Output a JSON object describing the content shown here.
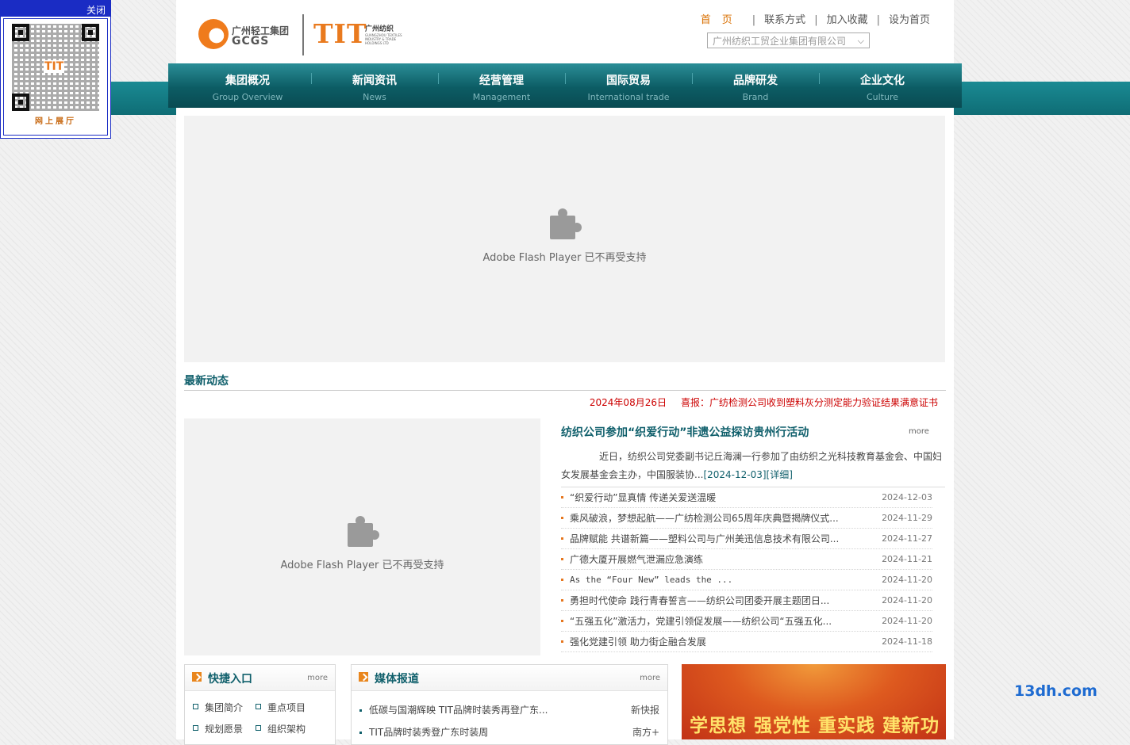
{
  "header": {
    "logo_gcgs_cn": "广州轻工集团",
    "logo_gcgs_en": "GCGS",
    "logo_tit_big": "TIT",
    "logo_tit_cn": "广州纺织",
    "logo_tit_en": "GUANGZHOU TEXTILES INDUSTRY & TRADE HOLDINGS LTD",
    "links": [
      "首页",
      "联系方式",
      "加入收藏",
      "设为首页"
    ],
    "site_select": "广州纺织工贸企业集团有限公司"
  },
  "nav": [
    {
      "cn": "集团概况",
      "en": "Group Overview"
    },
    {
      "cn": "新闻资讯",
      "en": "News"
    },
    {
      "cn": "经营管理",
      "en": "Management"
    },
    {
      "cn": "国际贸易",
      "en": "International trade"
    },
    {
      "cn": "品牌研发",
      "en": "Brand"
    },
    {
      "cn": "企业文化",
      "en": "Culture"
    }
  ],
  "flash_message": "Adobe Flash Player 已不再受支持",
  "latest": {
    "title": "最新动态",
    "ticker_date": "2024年08月26日",
    "ticker_text": "喜报：广纺检测公司收到塑料灰分测定能力验证结果满意证书"
  },
  "featured": {
    "title": "纺织公司参加“织爱行动”非遗公益探访贵州行活动",
    "more": "more",
    "body": "近日，纺织公司党委副书记丘海澜一行参加了由纺织之光科技教育基金会、中国妇女发展基金会主办，中国服装协...",
    "detail": "[2024-12-03][详细]"
  },
  "news": [
    {
      "title": "“织爱行动”显真情 传递关爱送温暖",
      "date": "2024-12-03"
    },
    {
      "title": "乘风破浪，梦想起航——广纺检测公司65周年庆典暨揭牌仪式...",
      "date": "2024-11-29"
    },
    {
      "title": "品牌赋能 共谱新篇——塑料公司与广州美迅信息技术有限公司...",
      "date": "2024-11-27"
    },
    {
      "title": "广德大厦开展燃气泄漏应急演练",
      "date": "2024-11-21"
    },
    {
      "title": "As the “Four New” leads the ...",
      "date": "2024-11-20"
    },
    {
      "title": "勇担时代使命 践行青春誓言——纺织公司团委开展主题团日...",
      "date": "2024-11-20"
    },
    {
      "title": "“五强五化”激活力，党建引领促发展——纺织公司“五强五化...",
      "date": "2024-11-20"
    },
    {
      "title": "强化党建引领 助力街企融合发展",
      "date": "2024-11-18"
    }
  ],
  "quick": {
    "title": "快捷入口",
    "more": "more",
    "items": [
      "集团简介",
      "重点项目",
      "规划愿景",
      "组织架构"
    ]
  },
  "media": {
    "title": "媒体报道",
    "more": "more",
    "items": [
      {
        "title": "低碳与国潮辉映 TIT品牌时装秀再登广东...",
        "source": "新快报"
      },
      {
        "title": "TIT品牌时装秀登广东时装周",
        "source": "南方+"
      }
    ]
  },
  "banner_text": "学思想 强党性 重实践 建新功",
  "qr": {
    "close": "关闭",
    "center": "TIT",
    "caption": "网上展厅"
  },
  "watermark": "13dh.com"
}
